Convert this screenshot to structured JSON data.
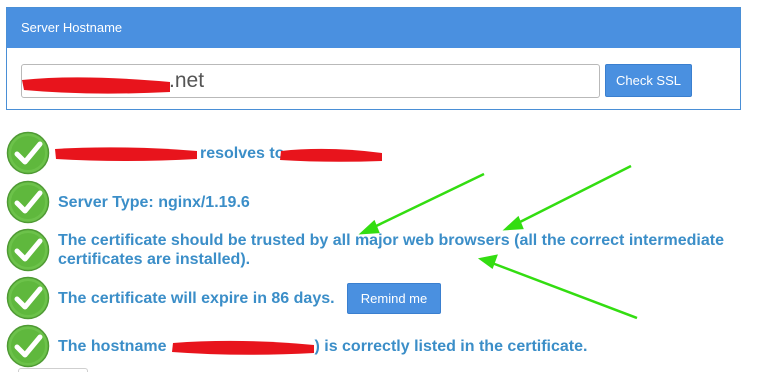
{
  "panel": {
    "title": "Server Hostname",
    "hostname_value": ".net",
    "check_label": "Check SSL"
  },
  "results": {
    "resolves_text": "resolves to",
    "server_type": "Server Type: nginx/1.19.6",
    "trusted_line1": "The certificate should be trusted by all major web browsers (all the correct intermediate",
    "trusted_line2": "certificates are installed).",
    "expire_text": "The certificate will expire in 86 days.",
    "remind_label": "Remind me",
    "hostname_prefix": "The hostname",
    "hostname_suffix": ") is correctly listed in the certificate."
  },
  "colors": {
    "accent": "#4a90e0",
    "text_blue": "#3b8ec8",
    "check_green": "#6cc24a",
    "redaction": "#e8141c",
    "annotation_arrow": "#33dd11"
  },
  "icons": {
    "status": "check-circle-icon"
  }
}
